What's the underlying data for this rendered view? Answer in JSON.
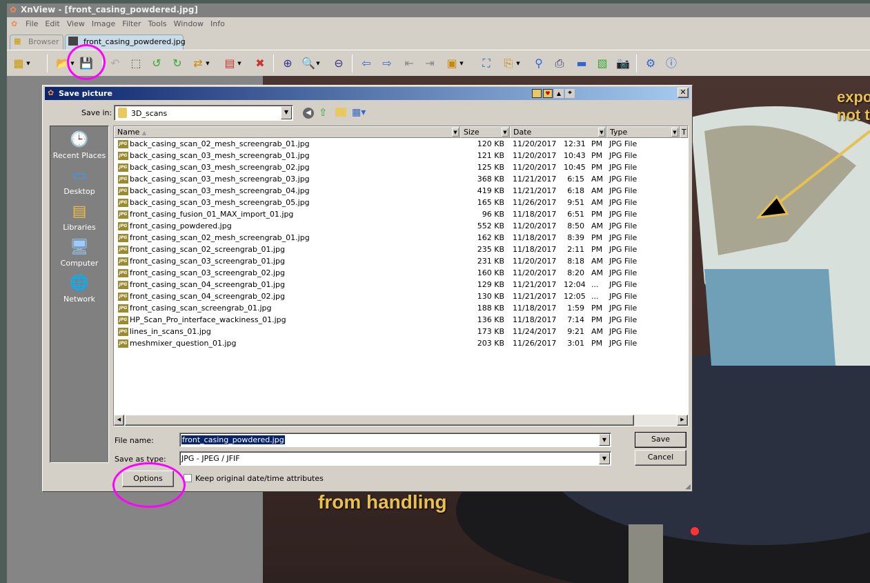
{
  "app": {
    "title": "XnView - [front_casing_powdered.jpg]",
    "menu": [
      "File",
      "Edit",
      "View",
      "Image",
      "Filter",
      "Tools",
      "Window",
      "Info"
    ],
    "tabs": [
      {
        "label": "Browser"
      },
      {
        "label": "front_casing_powdered.jpg"
      }
    ]
  },
  "toolbar": {
    "icons": [
      "browser-tree-icon",
      "open-icon",
      "save-icon",
      "undo-icon",
      "crop-icon",
      "rotate-left-icon",
      "rotate-right-icon",
      "convert-icon",
      "adjust-icon",
      "red-eye-icon",
      "zoom-in-icon",
      "zoom-1to1-icon",
      "zoom-out-icon",
      "previous-icon",
      "next-icon",
      "first-icon",
      "last-icon",
      "slideshow-icon",
      "fit-icon",
      "copy-to-icon",
      "find-icon",
      "print-icon",
      "scan-icon",
      "capture-icon",
      "camera-icon",
      "settings-icon",
      "info-icon"
    ]
  },
  "photo": {
    "annotation_top": [
      "expos",
      "not th"
    ],
    "annotation_bottom": "from handling"
  },
  "dialog": {
    "title": "Save picture",
    "save_in_label": "Save in:",
    "save_in_value": "3D_scans",
    "places": [
      "Recent Places",
      "Desktop",
      "Libraries",
      "Computer",
      "Network"
    ],
    "columns": [
      "Name",
      "Size",
      "Date",
      "Type",
      "T"
    ],
    "files": [
      {
        "name": "back_casing_scan_02_mesh_screengrab_01.jpg",
        "size": "120 KB",
        "date": "11/20/2017",
        "time": "12:31",
        "ampm": "PM",
        "type": "JPG File"
      },
      {
        "name": "back_casing_scan_03_mesh_screengrab_01.jpg",
        "size": "121 KB",
        "date": "11/20/2017",
        "time": "10:43",
        "ampm": "PM",
        "type": "JPG File"
      },
      {
        "name": "back_casing_scan_03_mesh_screengrab_02.jpg",
        "size": "125 KB",
        "date": "11/20/2017",
        "time": "10:45",
        "ampm": "PM",
        "type": "JPG File"
      },
      {
        "name": "back_casing_scan_03_mesh_screengrab_03.jpg",
        "size": "368 KB",
        "date": "11/21/2017",
        "time": "6:15",
        "ampm": "AM",
        "type": "JPG File"
      },
      {
        "name": "back_casing_scan_03_mesh_screengrab_04.jpg",
        "size": "419 KB",
        "date": "11/21/2017",
        "time": "6:18",
        "ampm": "AM",
        "type": "JPG File"
      },
      {
        "name": "back_casing_scan_03_mesh_screengrab_05.jpg",
        "size": "165 KB",
        "date": "11/26/2017",
        "time": "9:51",
        "ampm": "AM",
        "type": "JPG File"
      },
      {
        "name": "front_casing_fusion_01_MAX_import_01.jpg",
        "size": "96 KB",
        "date": "11/18/2017",
        "time": "6:51",
        "ampm": "PM",
        "type": "JPG File"
      },
      {
        "name": "front_casing_powdered.jpg",
        "size": "552 KB",
        "date": "11/20/2017",
        "time": "8:50",
        "ampm": "AM",
        "type": "JPG File"
      },
      {
        "name": "front_casing_scan_02_mesh_screengrab_01.jpg",
        "size": "162 KB",
        "date": "11/18/2017",
        "time": "8:39",
        "ampm": "PM",
        "type": "JPG File"
      },
      {
        "name": "front_casing_scan_02_screengrab_01.jpg",
        "size": "235 KB",
        "date": "11/18/2017",
        "time": "2:11",
        "ampm": "PM",
        "type": "JPG File"
      },
      {
        "name": "front_casing_scan_03_screengrab_01.jpg",
        "size": "231 KB",
        "date": "11/20/2017",
        "time": "8:18",
        "ampm": "AM",
        "type": "JPG File"
      },
      {
        "name": "front_casing_scan_03_screengrab_02.jpg",
        "size": "160 KB",
        "date": "11/20/2017",
        "time": "8:20",
        "ampm": "AM",
        "type": "JPG File"
      },
      {
        "name": "front_casing_scan_04_screengrab_01.jpg",
        "size": "129 KB",
        "date": "11/21/2017",
        "time": "12:04",
        "ampm": "...",
        "type": "JPG File"
      },
      {
        "name": "front_casing_scan_04_screengrab_02.jpg",
        "size": "130 KB",
        "date": "11/21/2017",
        "time": "12:05",
        "ampm": "...",
        "type": "JPG File"
      },
      {
        "name": "front_casing_scan_screengrab_01.jpg",
        "size": "188 KB",
        "date": "11/18/2017",
        "time": "1:59",
        "ampm": "PM",
        "type": "JPG File"
      },
      {
        "name": "HP_Scan_Pro_interface_wackiness_01.jpg",
        "size": "136 KB",
        "date": "11/18/2017",
        "time": "7:14",
        "ampm": "PM",
        "type": "JPG File"
      },
      {
        "name": "lines_in_scans_01.jpg",
        "size": "173 KB",
        "date": "11/24/2017",
        "time": "9:21",
        "ampm": "AM",
        "type": "JPG File"
      },
      {
        "name": "meshmixer_question_01.jpg",
        "size": "203 KB",
        "date": "11/26/2017",
        "time": "3:01",
        "ampm": "PM",
        "type": "JPG File"
      }
    ],
    "file_icon_label": "JPG",
    "file_name_label": "File name:",
    "file_name_value": "front_casing_powdered.jpg",
    "save_type_label": "Save as type:",
    "save_type_value": "JPG - JPEG / JFIF",
    "save_label": "Save",
    "cancel_label": "Cancel",
    "options_label": "Options",
    "keep_date_label": "Keep original date/time attributes",
    "keep_date_checked": false
  },
  "colors": {
    "highlight": "#f000f0",
    "title_active": "#0a246a",
    "annotation": "#e8c050"
  }
}
